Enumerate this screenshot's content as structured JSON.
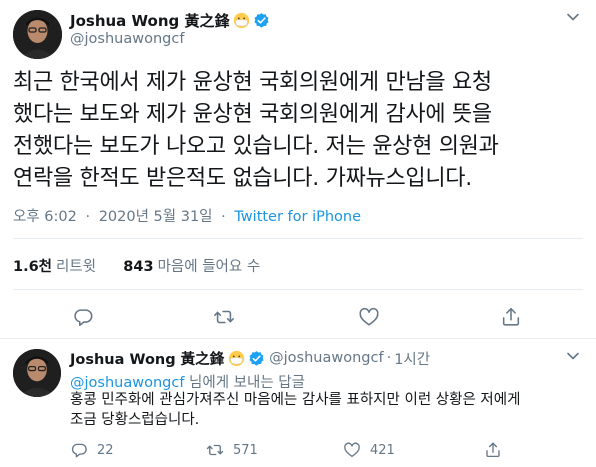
{
  "main_tweet": {
    "display_name": "Joshua Wong 黃之鋒",
    "handle": "@joshuawongcf",
    "text_lines": [
      "최근 한국에서 제가 윤상현 국회의원에게 만남을 요청",
      "했다는 보도와 제가 윤상현 국회의원에게 감사에 뜻을",
      "전했다는 보도가 나오고 있습니다. 저는 윤상현 의원과",
      "연락을 한적도 받은적도 없습니다. 가짜뉴스입니다."
    ],
    "time": "오후 6:02",
    "date": "2020년 5월 31일",
    "separator": "·",
    "source": "Twitter for iPhone",
    "retweets_count": "1.6천",
    "retweets_label": "리트윗",
    "likes_count": "843",
    "likes_label": "마음에 들어요 수"
  },
  "reply_tweet": {
    "display_name": "Joshua Wong 黃之鋒",
    "handle": "@joshuawongcf",
    "separator": "·",
    "time": "1시간",
    "replying_mention": "@joshuawongcf",
    "replying_rest": " 님에게 보내는 답글",
    "text_lines": [
      "홍콩 민주화에 관심가져주신 마음에는 감사를 표하지만 이런 상황은 저에게",
      "조금 당황스럽습니다."
    ],
    "reply_count": "22",
    "retweet_count": "571",
    "like_count": "421"
  },
  "colors": {
    "accent": "#1b95e0",
    "secondary_text": "#657786",
    "primary_text": "#14171a",
    "divider": "#e6ecf0",
    "verified": "#1da1f2"
  },
  "icons": {
    "verified": "verified-badge-icon",
    "emoji": "face-with-medical-mask-icon",
    "caret": "chevron-down-icon",
    "reply": "reply-icon",
    "retweet": "retweet-icon",
    "like": "heart-icon",
    "share": "share-icon"
  }
}
